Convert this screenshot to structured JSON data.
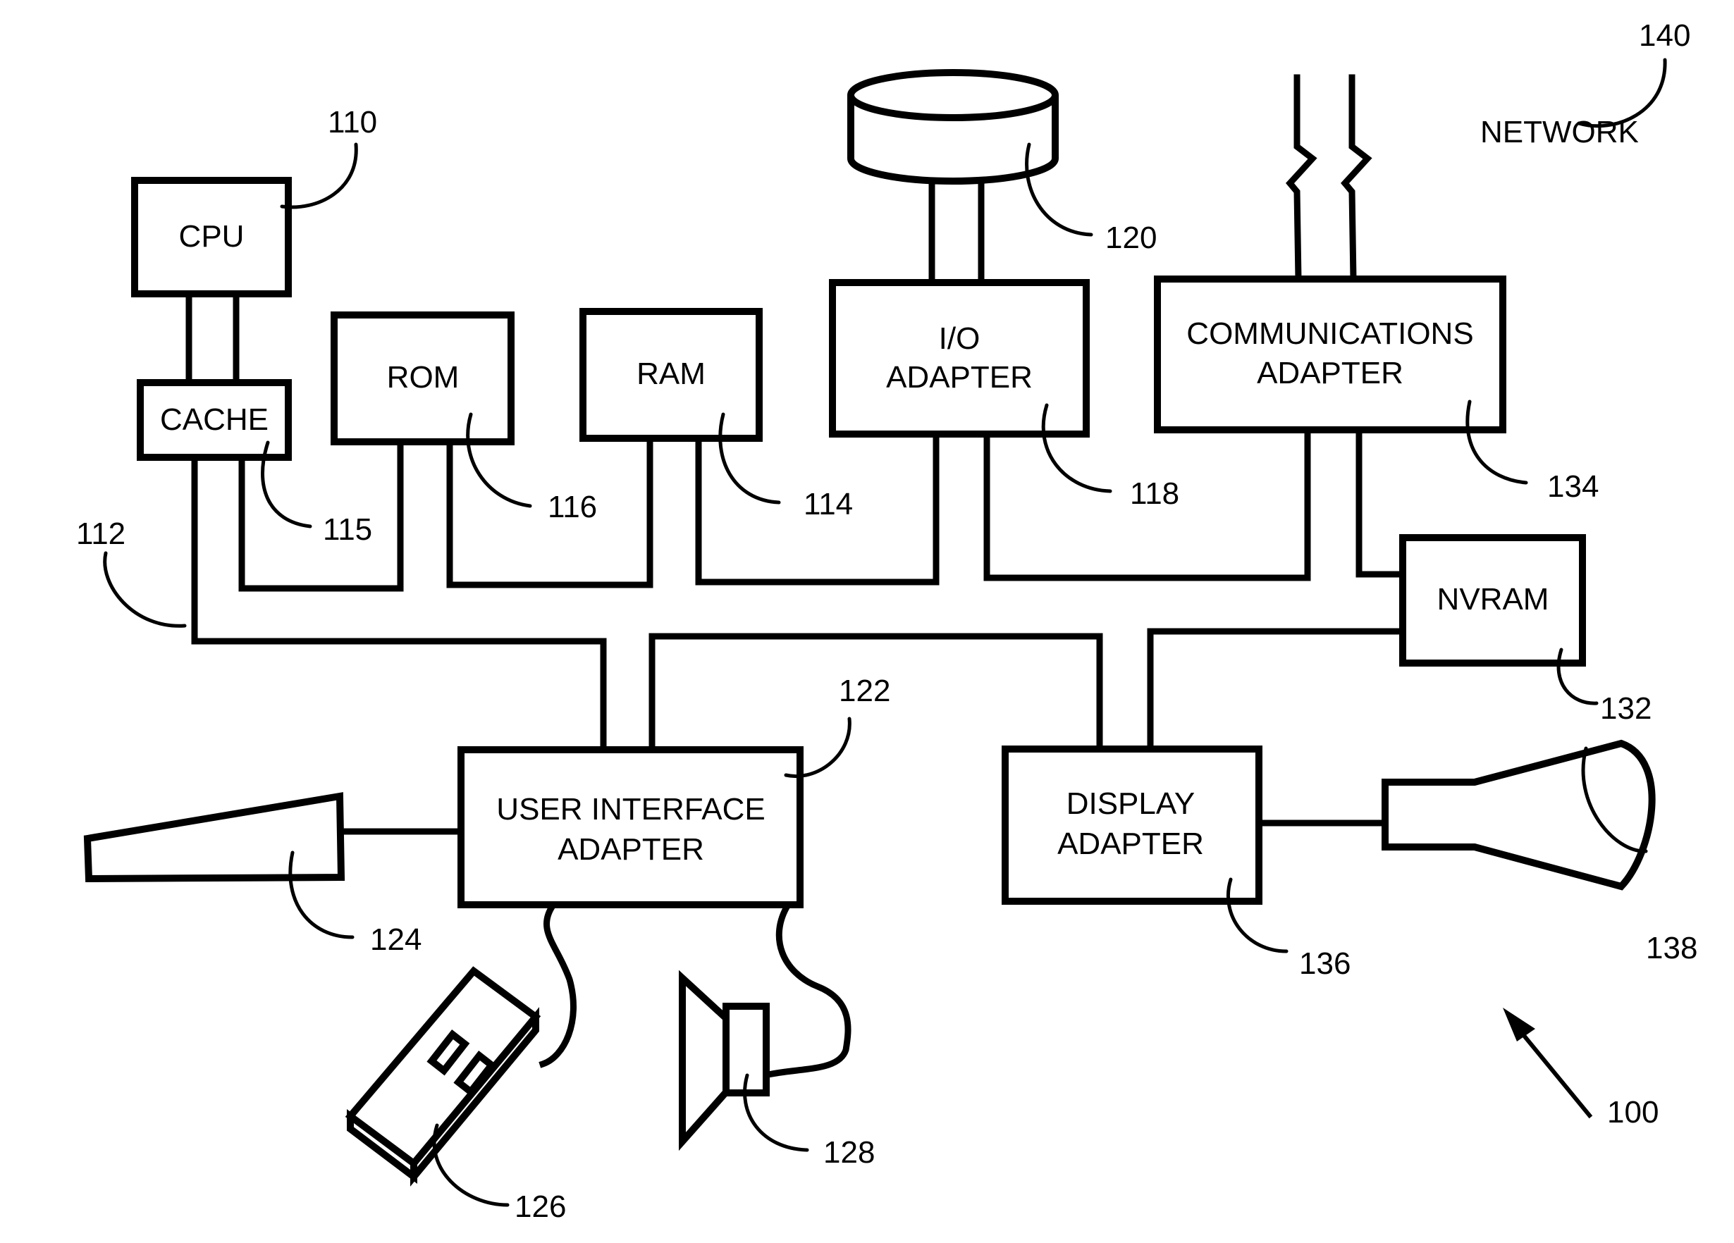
{
  "figure": {
    "reference": "100",
    "components": {
      "cpu": {
        "label": "CPU",
        "ref": "110"
      },
      "cache": {
        "label": "CACHE",
        "ref": "115"
      },
      "bus": {
        "ref": "112"
      },
      "rom": {
        "label": "ROM",
        "ref": "116"
      },
      "ram": {
        "label": "RAM",
        "ref": "114"
      },
      "io_adapter": {
        "label_line1": "I/O",
        "label_line2": "ADAPTER",
        "ref": "118"
      },
      "disk": {
        "ref": "120"
      },
      "comm_adapter": {
        "label_line1": "COMMUNICATIONS",
        "label_line2": "ADAPTER",
        "ref": "134"
      },
      "network": {
        "label": "NETWORK",
        "ref": "140"
      },
      "nvram": {
        "label": "NVRAM",
        "ref": "132"
      },
      "ui_adapter": {
        "label_line1": "USER INTERFACE",
        "label_line2": "ADAPTER",
        "ref": "122"
      },
      "keyboard": {
        "ref": "124"
      },
      "mouse": {
        "ref": "126"
      },
      "speaker": {
        "ref": "128"
      },
      "display_adapter": {
        "label_line1": "DISPLAY",
        "label_line2": "ADAPTER",
        "ref": "136"
      },
      "monitor": {
        "ref": "138"
      }
    }
  }
}
